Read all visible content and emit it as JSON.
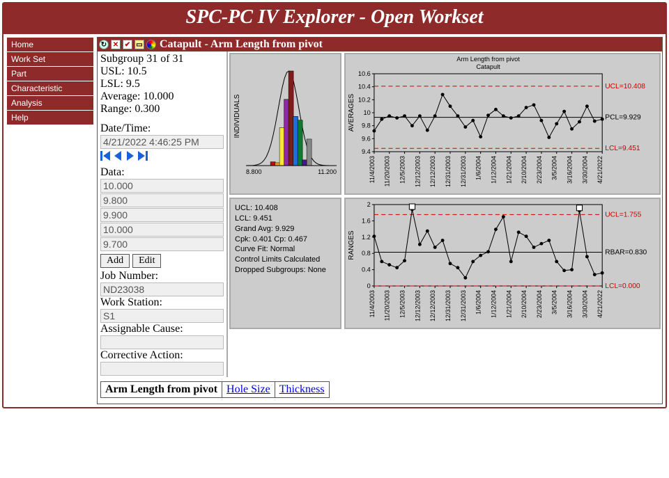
{
  "header": {
    "title": "SPC-PC IV Explorer - Open Workset"
  },
  "sidebar": {
    "items": [
      "Home",
      "Work Set",
      "Part",
      "Characteristic",
      "Analysis",
      "Help"
    ]
  },
  "panel": {
    "icons": [
      "refresh",
      "expand",
      "check",
      "note",
      "wheel"
    ],
    "title": "Catapult - Arm Length from pivot"
  },
  "info": {
    "subgroup_line": "Subgroup 31 of 31",
    "usl_line": "USL: 10.5",
    "lsl_line": "LSL: 9.5",
    "avg_line": "Average: 10.000",
    "range_line": "Range: 0.300",
    "datetime_label": "Date/Time:",
    "datetime_value": "4/21/2022 4:46:25 PM",
    "data_label": "Data:",
    "data_values": [
      "10.000",
      "9.800",
      "9.900",
      "10.000",
      "9.700"
    ],
    "add_label": "Add",
    "edit_label": "Edit",
    "job_label": "Job Number:",
    "job_value": "ND23038",
    "ws_label": "Work Station:",
    "ws_value": "S1",
    "cause_label": "Assignable Cause:",
    "cause_value": "",
    "action_label": "Corrective Action:",
    "action_value": ""
  },
  "stats": {
    "lines": [
      "UCL: 10.408",
      "LCL: 9.451",
      "Grand Avg: 9.929",
      "Cpk: 0.401  Cp: 0.467",
      "Curve Fit: Normal",
      "Control Limits Calculated",
      "Dropped Subgroups: None"
    ]
  },
  "histogram": {
    "ylabel": "INDIVIDUALS",
    "xmin_label": "8.800",
    "xmax_label": "11.200",
    "bars": [
      {
        "x": 0.27,
        "h": 0.04,
        "c": "#c00c0c"
      },
      {
        "x": 0.32,
        "h": 0.03,
        "c": "#f59e0b"
      },
      {
        "x": 0.37,
        "h": 0.4,
        "c": "#f7e733"
      },
      {
        "x": 0.42,
        "h": 0.7,
        "c": "#8e2aa0"
      },
      {
        "x": 0.47,
        "h": 1.0,
        "c": "#7f1d1d"
      },
      {
        "x": 0.52,
        "h": 0.52,
        "c": "#1e6fd9"
      },
      {
        "x": 0.57,
        "h": 0.48,
        "c": "#0a7d2f"
      },
      {
        "x": 0.62,
        "h": 0.06,
        "c": "#4a148c"
      },
      {
        "x": 0.67,
        "h": 0.28,
        "c": "#888"
      }
    ]
  },
  "tabs": {
    "items": [
      "Arm Length from pivot",
      "Hole Size",
      "Thickness"
    ],
    "selected": 0
  },
  "chart_data": [
    {
      "type": "line",
      "name": "averages",
      "title_line1": "Arm Length from pivot",
      "title_line2": "Catapult",
      "ylabel": "AVERAGES",
      "ylim": [
        9.4,
        10.6
      ],
      "yticks": [
        9.4,
        9.6,
        9.8,
        10.0,
        10.2,
        10.4,
        10.6
      ],
      "ucl": 10.408,
      "pcl": 9.929,
      "lcl": 9.451,
      "ucl_label": "UCL=10.408",
      "pcl_label": "PCL=9.929",
      "lcl_label": "LCL=9.451",
      "categories": [
        "11/4/2003",
        "11/20/2003",
        "12/5/2003",
        "12/12/2003",
        "12/12/2003",
        "12/31/2003",
        "12/31/2003",
        "1/6/2004",
        "1/12/2004",
        "1/21/2004",
        "2/10/2004",
        "2/23/2004",
        "3/5/2004",
        "3/16/2004",
        "3/30/2004",
        "4/21/2022"
      ],
      "values": [
        9.72,
        9.9,
        9.95,
        9.92,
        9.95,
        9.8,
        9.95,
        9.73,
        9.95,
        10.28,
        10.1,
        9.95,
        9.78,
        9.88,
        9.63,
        9.96,
        10.05,
        9.95,
        9.92,
        9.95,
        10.08,
        10.12,
        9.88,
        9.62,
        9.83,
        10.02,
        9.75,
        9.86,
        10.1,
        9.87,
        9.9
      ]
    },
    {
      "type": "line",
      "name": "ranges",
      "ylabel": "RANGES",
      "ylim": [
        0.0,
        2.0
      ],
      "yticks": [
        0.0,
        0.4,
        0.8,
        1.2,
        1.6,
        2.0
      ],
      "ucl": 1.755,
      "rbar": 0.83,
      "lcl": 0.0,
      "ucl_label": "UCL=1.755",
      "rbar_label": "RBAR=0.830",
      "lcl_label": "LCL=0.000",
      "categories": [
        "11/4/2003",
        "11/20/2003",
        "12/5/2003",
        "12/12/2003",
        "12/12/2003",
        "12/31/2003",
        "12/31/2003",
        "1/6/2004",
        "1/12/2004",
        "1/21/2004",
        "2/10/2004",
        "2/23/2004",
        "3/5/2004",
        "3/16/2004",
        "3/30/2004",
        "4/21/2022"
      ],
      "values": [
        1.22,
        0.6,
        0.52,
        0.45,
        0.62,
        1.88,
        1.02,
        1.35,
        0.95,
        1.12,
        0.55,
        0.45,
        0.2,
        0.6,
        0.75,
        0.84,
        1.39,
        1.7,
        0.6,
        1.32,
        1.22,
        0.95,
        1.04,
        1.12,
        0.6,
        0.38,
        0.4,
        1.85,
        0.72,
        0.28,
        0.32
      ]
    }
  ]
}
